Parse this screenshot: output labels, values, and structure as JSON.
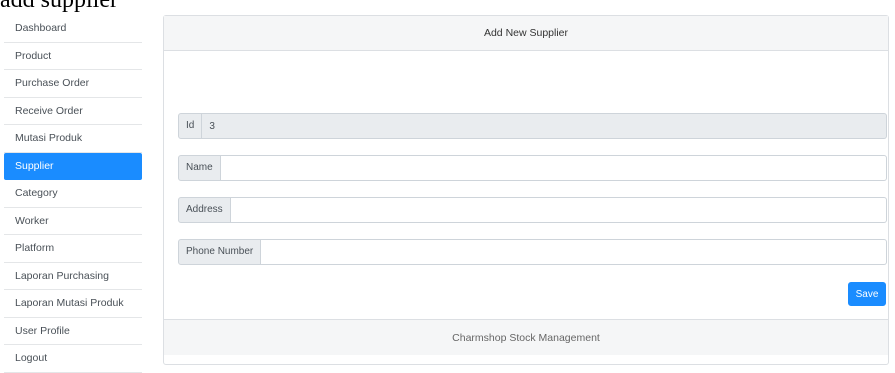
{
  "page": {
    "heading": "add supplier"
  },
  "sidebar": {
    "items": [
      {
        "label": "Dashboard"
      },
      {
        "label": "Product"
      },
      {
        "label": "Purchase Order"
      },
      {
        "label": "Receive Order"
      },
      {
        "label": "Mutasi Produk"
      },
      {
        "label": "Supplier"
      },
      {
        "label": "Category"
      },
      {
        "label": "Worker"
      },
      {
        "label": "Platform"
      },
      {
        "label": "Laporan Purchasing"
      },
      {
        "label": "Laporan Mutasi Produk"
      },
      {
        "label": "User Profile"
      },
      {
        "label": "Logout"
      }
    ],
    "active": "Supplier"
  },
  "form": {
    "title": "Add New Supplier",
    "id": {
      "label": "Id",
      "value": "3"
    },
    "name": {
      "label": "Name",
      "value": "",
      "placeholder": ""
    },
    "address": {
      "label": "Address",
      "value": "",
      "placeholder": ""
    },
    "phone": {
      "label": "Phone Number",
      "value": "",
      "placeholder": ""
    },
    "save_label": "Save"
  },
  "footer": {
    "text": "Charmshop Stock Management"
  },
  "colors": {
    "accent": "#1a8cff",
    "header_bg": "#f5f6f7",
    "addon_bg": "#e9ecef"
  }
}
